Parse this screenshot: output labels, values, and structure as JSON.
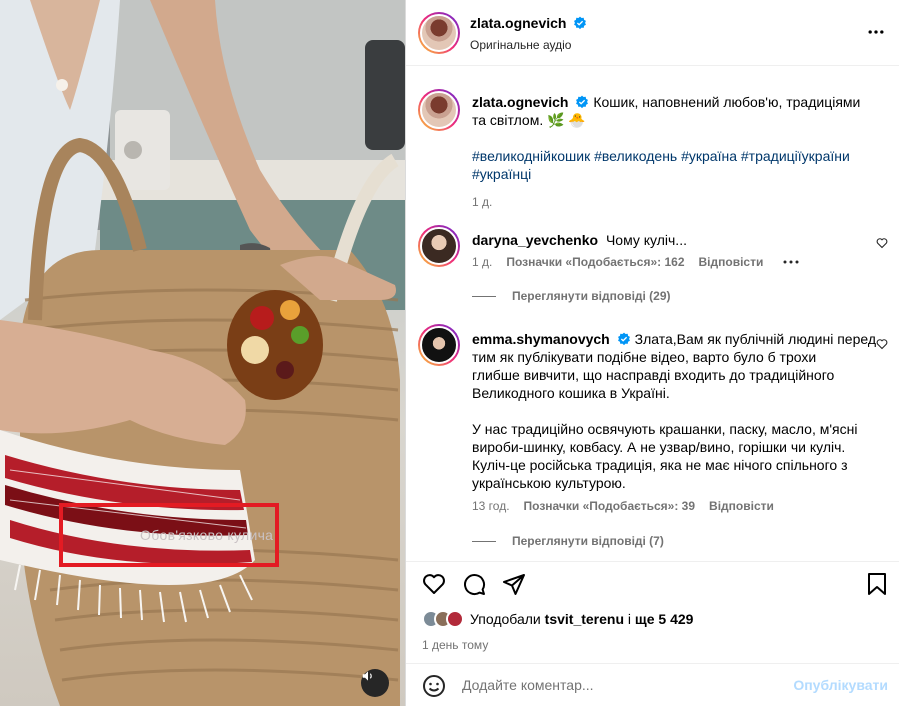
{
  "post": {
    "author": "zlata.ognevich",
    "audio": "Оригінальне аудіо",
    "caption_text": "Кошик, наповнений любов'ю, традиціями та світлом. 🌿 🐣",
    "hashtags_line1": "#великоднійкошик #великодень #україна #традиціїукраїни",
    "hashtags_line2": "#українці",
    "age": "1 д.",
    "video_overlay_text": "Обов'язково кулича"
  },
  "comments": [
    {
      "username": "daryna_yevchenko",
      "text": "Чому куліч...",
      "age": "1 д.",
      "likes": "Позначки «Подобається»: 162",
      "reply": "Відповісти",
      "view_replies": "Переглянути відповіді (29)"
    },
    {
      "username": "emma.shymanovych",
      "line1": "Злата,Вам як публічній людині перед",
      "line2": "тим як публікувати подібне відео, варто було б трохи",
      "line3": "глибше вивчити, що насправді входить до традиційного",
      "line4": "Великодного кошика в Україні.",
      "line5": "У нас традиційно освячують крашанки, паску, масло, м'ясні",
      "line6": "вироби-шинку, ковбасу. А не узвар/вино, горішки чи куліч.",
      "line7": "Куліч-це російська традиція, яка не має нічого спільного з",
      "line8": "українською культурою.",
      "age": "13 год.",
      "likes": "Позначки «Подобається»: 39",
      "reply": "Відповісти",
      "view_replies": "Переглянути відповіді (7)"
    }
  ],
  "likes": {
    "prefix": "Уподобали",
    "user": "tsvit_terenu",
    "connector": "і",
    "rest": "ще 5 429"
  },
  "date": "1 день тому",
  "composer": {
    "placeholder": "Додайте коментар...",
    "publish": "Опублікувати"
  },
  "colors": {
    "link": "#00376b",
    "muted": "#737373",
    "publish_disabled": "#b3dbff",
    "verified": "#0095f6",
    "highlight": "#e31b23"
  },
  "icons": [
    "verified-badge-icon",
    "more-options-icon",
    "heart-icon",
    "comment-icon",
    "share-icon",
    "save-icon",
    "emoji-icon",
    "mute-icon"
  ]
}
